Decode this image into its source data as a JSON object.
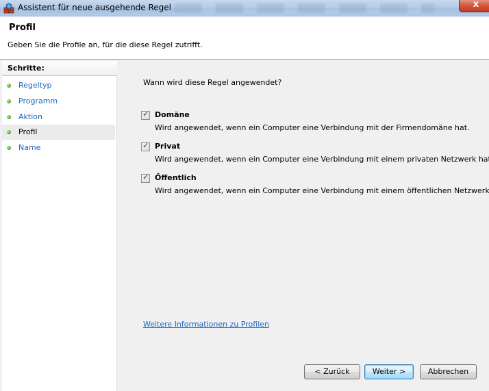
{
  "window": {
    "title": "Assistent für neue ausgehende Regel",
    "close_symbol": "x"
  },
  "header": {
    "title": "Profil",
    "subtitle": "Geben Sie die Profile an, für die diese Regel zutrifft."
  },
  "sidebar": {
    "title": "Schritte:",
    "items": [
      {
        "label": "Regeltyp"
      },
      {
        "label": "Programm"
      },
      {
        "label": "Aktion"
      },
      {
        "label": "Profil",
        "current": true
      },
      {
        "label": "Name"
      }
    ]
  },
  "main": {
    "question": "Wann wird diese Regel angewendet?",
    "options": [
      {
        "name": "Domäne",
        "description": "Wird angewendet, wenn ein Computer eine Verbindung mit der Firmendomäne hat.",
        "checked": true
      },
      {
        "name": "Privat",
        "description": "Wird angewendet, wenn ein Computer eine Verbindung mit einem privaten Netzwerk hat.",
        "checked": true
      },
      {
        "name": "Öffentlich",
        "description": "Wird angewendet, wenn ein Computer eine Verbindung mit einem öffentlichen Netzwerk hat.",
        "checked": true
      }
    ],
    "more_info_link": "Weitere Informationen zu Profilen"
  },
  "buttons": {
    "back": "< Zurück",
    "next": "Weiter >",
    "cancel": "Abbrechen"
  },
  "icons": {
    "app": "firewall-wall-icon",
    "step_bullet": "green-dot-icon",
    "checkmark": "✓"
  }
}
